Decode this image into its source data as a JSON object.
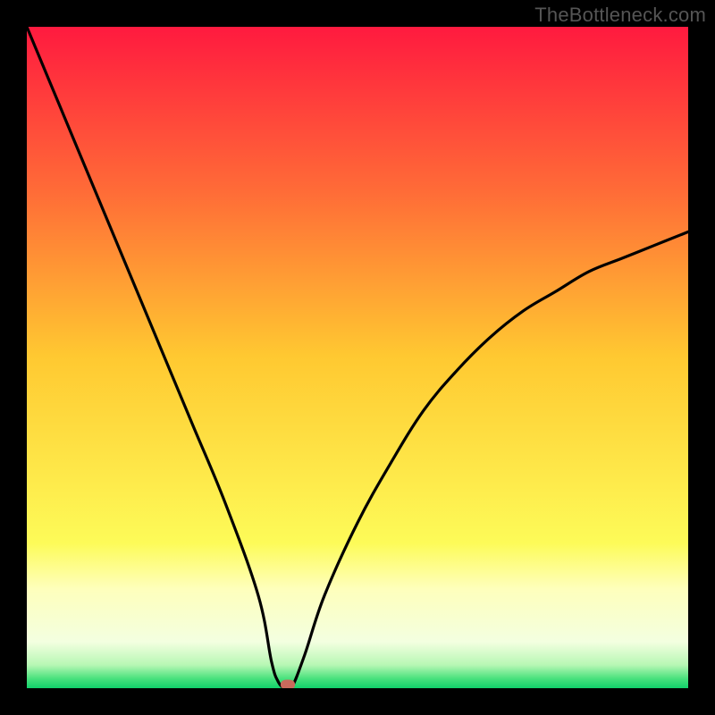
{
  "watermark": "TheBottleneck.com",
  "colors": {
    "frame": "#000000",
    "curve": "#000000",
    "marker": "#C96A5C",
    "watermark": "#555555",
    "gradient_stops": [
      {
        "pos": 0.0,
        "color": "#FF1A3F"
      },
      {
        "pos": 0.25,
        "color": "#FF6C37"
      },
      {
        "pos": 0.5,
        "color": "#FFC931"
      },
      {
        "pos": 0.78,
        "color": "#FDFB58"
      },
      {
        "pos": 0.85,
        "color": "#FEFFBC"
      },
      {
        "pos": 0.93,
        "color": "#F3FFE0"
      },
      {
        "pos": 0.965,
        "color": "#B7F7B4"
      },
      {
        "pos": 0.985,
        "color": "#4BE27E"
      },
      {
        "pos": 1.0,
        "color": "#11D06B"
      }
    ]
  },
  "chart_data": {
    "type": "line",
    "title": "",
    "xlabel": "",
    "ylabel": "",
    "xlim": [
      0,
      100
    ],
    "ylim": [
      0,
      100
    ],
    "series": [
      {
        "name": "bottleneck-curve",
        "x": [
          0,
          5,
          10,
          15,
          20,
          25,
          30,
          35,
          37,
          38,
          39,
          40,
          42,
          45,
          50,
          55,
          60,
          65,
          70,
          75,
          80,
          85,
          90,
          95,
          100
        ],
        "values": [
          100,
          88,
          76,
          64,
          52,
          40,
          28,
          14,
          4,
          1,
          0,
          0,
          5,
          14,
          25,
          34,
          42,
          48,
          53,
          57,
          60,
          63,
          65,
          67,
          69
        ]
      }
    ],
    "marker": {
      "x": 39.5,
      "y": 0.5
    }
  }
}
